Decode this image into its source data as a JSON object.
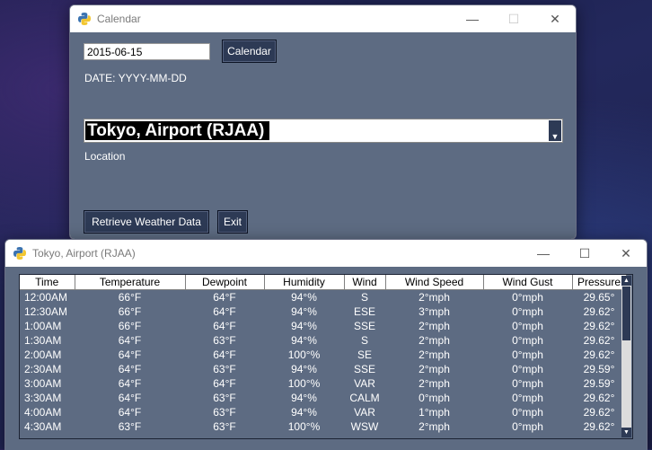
{
  "calendar_window": {
    "title": "Calendar",
    "date_value": "2015-06-15",
    "calendar_button": "Calendar",
    "date_format_label": "DATE: YYYY-MM-DD",
    "location_selected": "Tokyo, Airport (RJAA)",
    "location_label": "Location",
    "retrieve_button": "Retrieve Weather Data",
    "exit_button": "Exit",
    "controls": {
      "minimize": "—",
      "maximize": "☐",
      "close": "✕"
    }
  },
  "data_window": {
    "title": "Tokyo, Airport (RJAA)",
    "controls": {
      "minimize": "—",
      "maximize": "☐",
      "close": "✕"
    },
    "columns": [
      "Time",
      "Temperature",
      "Dewpoint",
      "Humidity",
      "Wind",
      "Wind Speed",
      "Wind Gust",
      "Pressure"
    ],
    "rows": [
      [
        "12:00AM",
        "66°F",
        "64°F",
        "94°%",
        "S",
        "2°mph",
        "0°mph",
        "29.65°"
      ],
      [
        "12:30AM",
        "66°F",
        "64°F",
        "94°%",
        "ESE",
        "3°mph",
        "0°mph",
        "29.62°"
      ],
      [
        "1:00AM",
        "66°F",
        "64°F",
        "94°%",
        "SSE",
        "2°mph",
        "0°mph",
        "29.62°"
      ],
      [
        "1:30AM",
        "64°F",
        "63°F",
        "94°%",
        "S",
        "2°mph",
        "0°mph",
        "29.62°"
      ],
      [
        "2:00AM",
        "64°F",
        "64°F",
        "100°%",
        "SE",
        "2°mph",
        "0°mph",
        "29.62°"
      ],
      [
        "2:30AM",
        "64°F",
        "63°F",
        "94°%",
        "SSE",
        "2°mph",
        "0°mph",
        "29.59°"
      ],
      [
        "3:00AM",
        "64°F",
        "64°F",
        "100°%",
        "VAR",
        "2°mph",
        "0°mph",
        "29.59°"
      ],
      [
        "3:30AM",
        "64°F",
        "63°F",
        "94°%",
        "CALM",
        "0°mph",
        "0°mph",
        "29.62°"
      ],
      [
        "4:00AM",
        "64°F",
        "63°F",
        "94°%",
        "VAR",
        "1°mph",
        "0°mph",
        "29.62°"
      ],
      [
        "4:30AM",
        "63°F",
        "63°F",
        "100°%",
        "WSW",
        "2°mph",
        "0°mph",
        "29.62°"
      ]
    ]
  }
}
